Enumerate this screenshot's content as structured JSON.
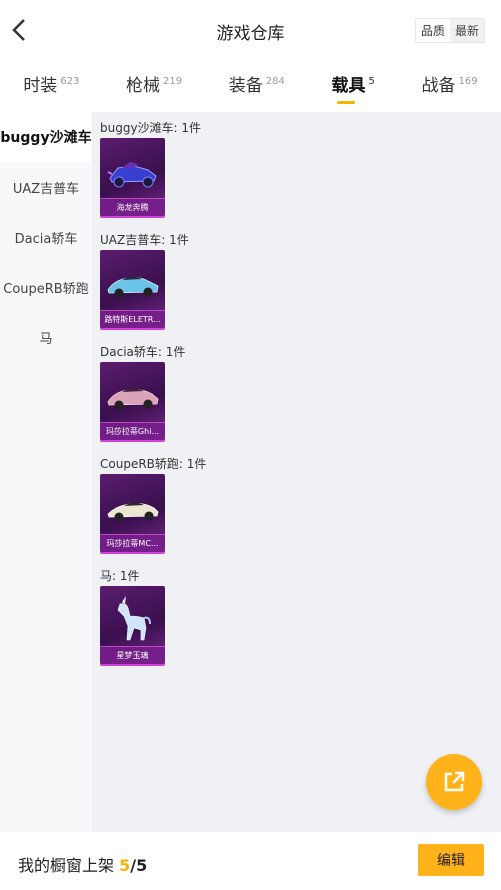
{
  "header": {
    "title": "游戏仓库",
    "sort_quality": "品质",
    "sort_latest": "最新"
  },
  "tabs": [
    {
      "label": "时装",
      "count": "623"
    },
    {
      "label": "枪械",
      "count": "219"
    },
    {
      "label": "装备",
      "count": "284"
    },
    {
      "label": "载具",
      "count": "5"
    },
    {
      "label": "战备",
      "count": "169"
    }
  ],
  "sidebar": {
    "items": [
      "buggy沙滩车",
      "UAZ吉普车",
      "Dacia轿车",
      "CoupeRB轿跑",
      "马"
    ]
  },
  "groups": [
    {
      "title": "buggy沙滩车: 1件",
      "item": "海龙奔腾",
      "icon": "buggy-icon"
    },
    {
      "title": "UAZ吉普车: 1件",
      "item": "路特斯ELETR...",
      "icon": "car-icon"
    },
    {
      "title": "Dacia轿车: 1件",
      "item": "玛莎拉蒂Ghi...",
      "icon": "car-icon"
    },
    {
      "title": "CoupeRB轿跑: 1件",
      "item": "玛莎拉蒂MC...",
      "icon": "car-icon"
    },
    {
      "title": "马: 1件",
      "item": "星梦玉璃",
      "icon": "unicorn-icon"
    }
  ],
  "colors": {
    "accent": "#ffb21a",
    "card_bg": "#4a1660",
    "card_glow": "#d340d8"
  },
  "footer": {
    "label": "我的橱窗上架",
    "current": "5",
    "total": "/5",
    "edit": "编辑"
  }
}
